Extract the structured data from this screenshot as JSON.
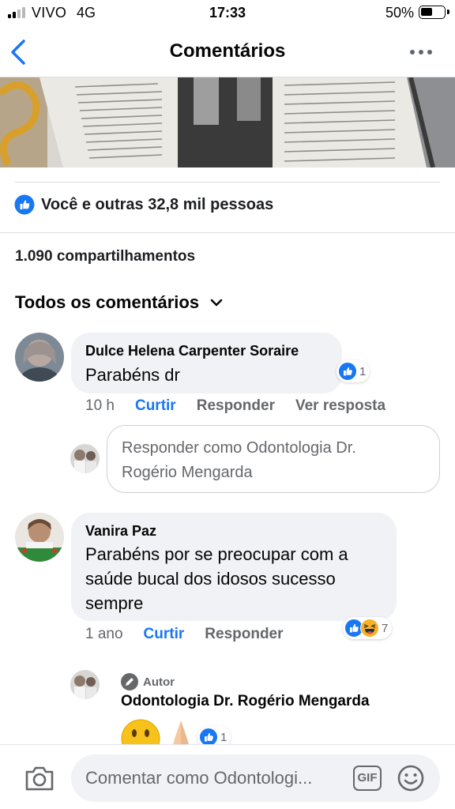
{
  "status_bar": {
    "carrier": "VIVO",
    "network": "4G",
    "time": "17:33",
    "battery": "50%",
    "battery_level": 0.5
  },
  "header": {
    "title": "Comentários"
  },
  "reactions": {
    "summary": "Você e outras 32,8 mil pessoas"
  },
  "shares": "1.090 compartilhamentos",
  "sort_label": "Todos os comentários",
  "comments": [
    {
      "author": "Dulce Helena Carpenter Soraire",
      "text": "Parabéns dr",
      "time": "10 h",
      "like": "Curtir",
      "reply": "Responder",
      "view_reply": "Ver resposta",
      "reaction_count": "1"
    },
    {
      "author": "Vanira Paz",
      "text_lines": [
        "Parabéns por se preocupar com a",
        "saúde bucal dos idosos sucesso",
        "sempre"
      ],
      "time": "1 ano",
      "like": "Curtir",
      "reply": "Responder",
      "reaction_count": "7"
    }
  ],
  "reply_box": {
    "placeholder_lines": [
      "Responder como Odontologia Dr.",
      "Rogério Mengarda"
    ]
  },
  "author_reply": {
    "badge": "Autor",
    "name": "Odontologia Dr. Rogério Mengarda",
    "reaction_count": "1"
  },
  "composer": {
    "placeholder": "Comentar como Odontologi...",
    "gif_label": "GIF"
  },
  "colors": {
    "accent": "#1877f2",
    "bubble": "#f0f2f5",
    "secondary_text": "#65676b"
  }
}
